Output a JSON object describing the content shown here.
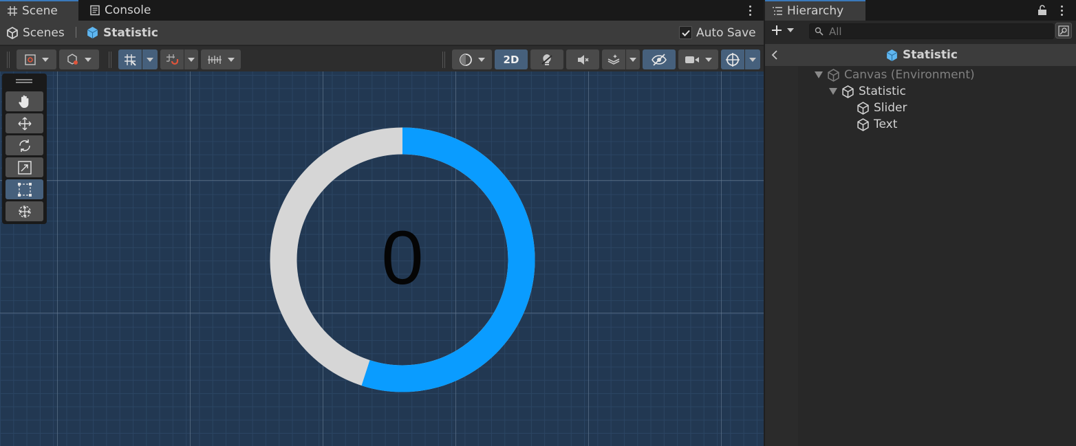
{
  "scene_tabs": {
    "scene": "Scene",
    "console": "Console"
  },
  "breadcrumb": {
    "scenes": "Scenes",
    "current": "Statistic"
  },
  "auto_save": {
    "label": "Auto Save",
    "checked": true
  },
  "toolbar": {
    "mode_2d": "2D"
  },
  "viewport": {
    "statistic_value": "0",
    "ring": {
      "fill_fraction": 0.55,
      "fill_color": "#0a9cff",
      "track_color": "#d6d6d6"
    }
  },
  "hierarchy": {
    "tab": "Hierarchy",
    "search_placeholder": "All",
    "header": "Statistic",
    "tree": [
      {
        "label": "Canvas (Environment)",
        "depth": 0,
        "expanded": true,
        "dim": true
      },
      {
        "label": "Statistic",
        "depth": 1,
        "expanded": true,
        "dim": false
      },
      {
        "label": "Slider",
        "depth": 2,
        "expanded": false,
        "dim": false
      },
      {
        "label": "Text",
        "depth": 2,
        "expanded": false,
        "dim": false
      }
    ]
  },
  "colors": {
    "accent_blue": "#3a79bb",
    "selected_tool": "#46607c",
    "viewport_bg": "#223852"
  }
}
